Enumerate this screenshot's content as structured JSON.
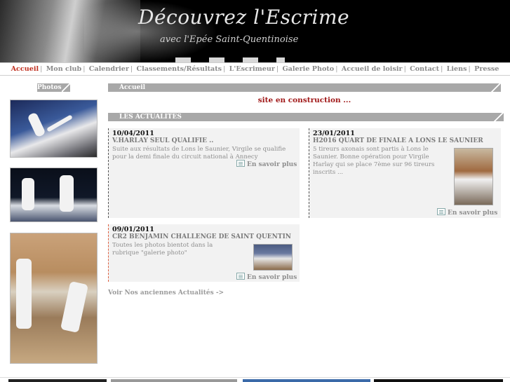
{
  "banner": {
    "title": "Découvrez  l'Escrime",
    "subtitle": "avec l'Epée Saint-Quentinoise"
  },
  "nav": {
    "items": [
      {
        "label": "Accueil",
        "active": true
      },
      {
        "label": "Mon club"
      },
      {
        "label": "Calendrier"
      },
      {
        "label": "Classements/Résultats"
      },
      {
        "label": "L'Escrimeur"
      },
      {
        "label": "Galerie Photo"
      },
      {
        "label": "Accueil de loisir"
      },
      {
        "label": "Contact"
      },
      {
        "label": "Liens"
      },
      {
        "label": "Presse"
      }
    ],
    "separator": "|"
  },
  "sidebar": {
    "heading": "Photos"
  },
  "main": {
    "accueil_heading": "Accueil",
    "construction": "site en construction ...",
    "actus_heading": "LES ACTUALITES",
    "news": [
      {
        "date": "10/04/2011",
        "title": "V.HARLAY SEUL QUALIFIE ..",
        "body": "Suite aux résultats de Lons le Saunier, Virgile se qualifie pour la demi finale du circuit national à Annecy",
        "more": "En savoir plus"
      },
      {
        "date": "23/01/2011",
        "title": "H2016 QUART DE FINALE A LONS LE SAUNIER",
        "body": "5 tireurs axonais sont partis à Lons le Saunier. Bonne opération pour Virgile Harlay qui se place 7ème sur 96 tireurs inscrits ...",
        "more": "En savoir plus"
      },
      {
        "date": "09/01/2011",
        "title": "CR2 BENJAMIN CHALLENGE DE SAINT QUENTIN",
        "body": "Toutes les photos bientot dans la rubrique \"galerie photo\"",
        "more": "En savoir plus"
      }
    ],
    "older_link": "Voir Nos anciennes Actualités ->"
  }
}
